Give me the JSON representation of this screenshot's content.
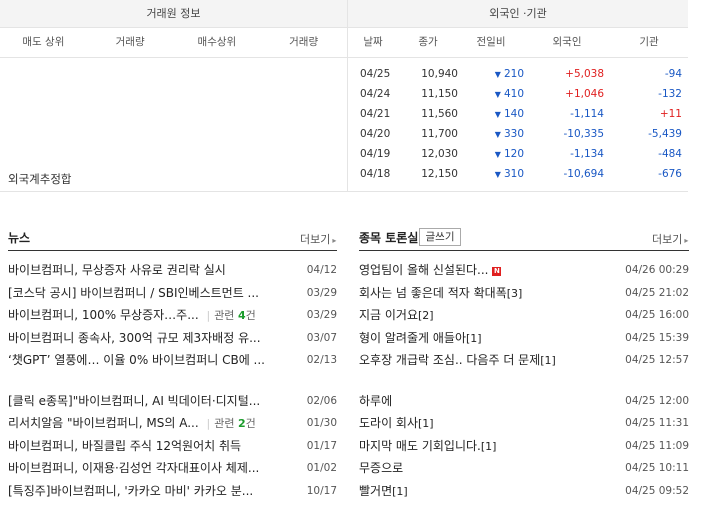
{
  "trader_panel": {
    "title": "거래원 정보",
    "columns": [
      "매도 상위",
      "거래량",
      "매수상위",
      "거래량"
    ],
    "foreign_total_label": "외국계추정합"
  },
  "investor_panel": {
    "title": "외국인 ·기관",
    "columns": [
      "날짜",
      "종가",
      "전일비",
      "외국인",
      "기관"
    ],
    "rows": [
      {
        "date": "04/25",
        "close": "10,940",
        "change": "210",
        "foreign": "+5,038",
        "institution": "-94"
      },
      {
        "date": "04/24",
        "close": "11,150",
        "change": "410",
        "foreign": "+1,046",
        "institution": "-132"
      },
      {
        "date": "04/21",
        "close": "11,560",
        "change": "140",
        "foreign": "-1,114",
        "institution": "+11"
      },
      {
        "date": "04/20",
        "close": "11,700",
        "change": "330",
        "foreign": "-10,335",
        "institution": "-5,439"
      },
      {
        "date": "04/19",
        "close": "12,030",
        "change": "120",
        "foreign": "-1,134",
        "institution": "-484"
      },
      {
        "date": "04/18",
        "close": "12,150",
        "change": "310",
        "foreign": "-10,694",
        "institution": "-676"
      }
    ]
  },
  "news": {
    "title": "뉴스",
    "more": "더보기",
    "items": [
      {
        "title": "바이브컴퍼니, 무상증자 사유로 권리락 실시",
        "date": "04/12"
      },
      {
        "title": "[코스닥 공시] 바이브컴퍼니 / SBI인베스트먼트 ...",
        "date": "03/29"
      },
      {
        "title": "바이브컴퍼니, 100% 무상증자…주...",
        "related": "관련",
        "related_count": "4",
        "related_unit": "건",
        "date": "03/29"
      },
      {
        "title": "바이브컴퍼니 종속사, 300억 규모 제3자배정 유...",
        "date": "03/07"
      },
      {
        "title": "‘챗GPT’ 열풍에… 이율 0% 바이브컴퍼니 CB에 ...",
        "date": "02/13"
      },
      {
        "title": "[클릭 e종목]\"바이브컴퍼니, AI 빅데이터·디지털...",
        "date": "02/06"
      },
      {
        "title": "리서치알음 \"바이브컴퍼니, MS의 A...",
        "related": "관련",
        "related_count": "2",
        "related_unit": "건",
        "date": "01/30"
      },
      {
        "title": "바이브컴퍼니, 바질클립 주식 12억원어치 취득",
        "date": "01/17"
      },
      {
        "title": "바이브컴퍼니, 이재용·김성언 각자대표이사 체제...",
        "date": "01/02"
      },
      {
        "title": "[특징주]바이브컴퍼니, '카카오 마비' 카카오 분...",
        "date": "10/17"
      }
    ]
  },
  "board": {
    "title": "종목 토론실",
    "write_button": "글쓰기",
    "more": "더보기",
    "new_badge": "N",
    "items": [
      {
        "title": "영업팀이 올해 신설된다...",
        "new": true,
        "date": "04/26 00:29"
      },
      {
        "title": "회사는 넘 좋은데 적자 확대폭",
        "comments": "[3]",
        "date": "04/25 21:02"
      },
      {
        "title": "지금 이거요",
        "comments": "[2]",
        "date": "04/25 16:00"
      },
      {
        "title": "형이 알려줄게 애들아",
        "comments": "[1]",
        "date": "04/25 15:39"
      },
      {
        "title": "오후장 개급락 조심.. 다음주 더 문제",
        "comments": "[1]",
        "date": "04/25 12:57"
      },
      {
        "title": "하루에",
        "date": "04/25 12:00"
      },
      {
        "title": "도라이 회사",
        "comments": "[1]",
        "date": "04/25 11:31"
      },
      {
        "title": "마지막 매도 기회입니다.",
        "comments": "[1]",
        "date": "04/25 11:09"
      },
      {
        "title": "무증으로",
        "date": "04/25 10:11"
      },
      {
        "title": "빨거면",
        "comments": "[1]",
        "date": "04/25 09:52"
      }
    ]
  },
  "colors": {
    "up": "#e02020",
    "down": "#1a58c4",
    "related_count": "#1c9c2c"
  },
  "icons": {
    "down_change": "down-triangle-icon",
    "more_arrow": "chevron-right-icon"
  }
}
